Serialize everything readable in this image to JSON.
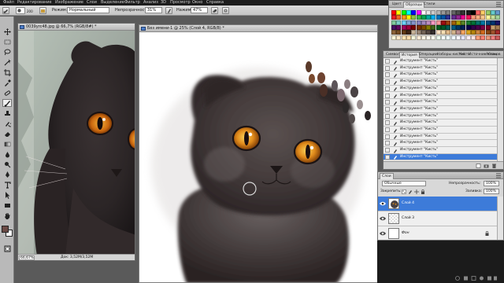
{
  "menu": {
    "items": [
      "Файл",
      "Редактирование",
      "Изображение",
      "Слои",
      "Выделение",
      "Фильтр",
      "Анализ",
      "3D",
      "Просмотр",
      "Окно",
      "Справка"
    ]
  },
  "options": {
    "brush_size": "200",
    "mode_label": "Режим:",
    "mode_value": "Нормальный",
    "opacity_label": "Непрозрачность:",
    "opacity_value": "31%",
    "flow_label": "Нажим:",
    "flow_value": "47%"
  },
  "doc1": {
    "title": "0039yrc48.jpg @ 66,7% (RGB/8#) *",
    "zoom": "66,67%",
    "info": "Док: 3,52M/3,52M"
  },
  "doc2": {
    "title": "Без имени-1 @ 25% (Слой 4, RGB/8) *"
  },
  "swatches": {
    "tabs": [
      "Цвет",
      "Образцы",
      "Стили"
    ],
    "active_tab": 1,
    "colors": [
      "#ff0000",
      "#ffff00",
      "#00ff00",
      "#00ffff",
      "#0000ff",
      "#ff00ff",
      "#ffffff",
      "#e6e6e6",
      "#cccccc",
      "#b3b3b3",
      "#999999",
      "#808080",
      "#666666",
      "#4d4d4d",
      "#333333",
      "#1a1a1a",
      "#000000",
      "#ff6666",
      "#ffcc66",
      "#99cc66",
      "#66cccc",
      "#6699cc",
      "#ed1c24",
      "#f26522",
      "#f7941d",
      "#fff200",
      "#8dc63f",
      "#39b54a",
      "#00a651",
      "#00a99d",
      "#00aeef",
      "#0072bc",
      "#0054a6",
      "#2e3192",
      "#662d91",
      "#92278f",
      "#ec008c",
      "#ed145b",
      "#f7977a",
      "#f9ad81",
      "#fdc68a",
      "#fff79a",
      "#c4df9b",
      "#a3d39c",
      "#82ca9d",
      "#7bcdc8",
      "#6ecff6",
      "#7ea7d8",
      "#8493ca",
      "#8882be",
      "#a187be",
      "#bc8dbf",
      "#f49ac2",
      "#f6989d",
      "#9e0b0f",
      "#a0410d",
      "#a36209",
      "#aba000",
      "#598527",
      "#1a7b30",
      "#007236",
      "#00746b",
      "#0076a3",
      "#004b80",
      "#003471",
      "#1b1464",
      "#440e62",
      "#630460",
      "#9e005d",
      "#9e0039",
      "#790000",
      "#7b2e00",
      "#7d4900",
      "#827b00",
      "#406618",
      "#005e20",
      "#005826",
      "#005952",
      "#005b7f",
      "#003663",
      "#002157",
      "#0d004c",
      "#32004b",
      "#4b0049",
      "#7b0046",
      "#7a0026",
      "#c69c6d",
      "#a67c52",
      "#8c6239",
      "#754c24",
      "#603913",
      "#3c2415",
      "#c7b299",
      "#998675",
      "#736357",
      "#534741",
      "#362f2d",
      "#ffe4c4",
      "#f5deb3",
      "#deb887",
      "#d2b48c",
      "#bc8f8f",
      "#f4a460",
      "#daa520",
      "#b8860b",
      "#cd853f",
      "#d2691e",
      "#8b4513",
      "#a0522d",
      "#a52a2a",
      "#fff8dc",
      "#ffebcd",
      "#ffe4b5",
      "#ffdead",
      "#f5f5dc",
      "#faebd7",
      "#fdf5e6",
      "#fffaf0",
      "#fffff0",
      "#f0fff0",
      "#f5fffa",
      "#f0ffff",
      "#f0f8ff",
      "#f8f8ff",
      "#e6e6fa",
      "#fff0f5",
      "#ffe4e1",
      "#ffa07a",
      "#fa8072",
      "#e9967a",
      "#f08080",
      "#cd5c5c"
    ]
  },
  "history": {
    "tabs": [
      "Символ",
      "История",
      "Операции",
      "Наборы кистей",
      "Кисть",
      "Источник клонов",
      "Абзац"
    ],
    "active_tab": 1,
    "items": [
      "Инструмент \"Кисть\"",
      "Инструмент \"Кисть\"",
      "Инструмент \"Кисть\"",
      "Инструмент \"Кисть\"",
      "Инструмент \"Кисть\"",
      "Инструмент \"Кисть\"",
      "Инструмент \"Кисть\"",
      "Инструмент \"Кисть\"",
      "Инструмент \"Кисть\"",
      "Инструмент \"Кисть\"",
      "Инструмент \"Кисть\"",
      "Инструмент \"Кисть\"",
      "Инструмент \"Кисть\"",
      "Инструмент \"Кисть\"",
      "Инструмент \"Кисть\""
    ],
    "selected_index": 14
  },
  "layers": {
    "title": "Слои",
    "blend_mode": "Обычные",
    "opacity_label": "Непрозрачность:",
    "opacity_value": "100%",
    "lock_label": "Закрепить:",
    "fill_label": "Заливка:",
    "fill_value": "100%",
    "items": [
      {
        "name": "Слой 4",
        "selected": true
      },
      {
        "name": "Слой 3",
        "selected": false
      },
      {
        "name": "Фон",
        "selected": false
      }
    ]
  }
}
